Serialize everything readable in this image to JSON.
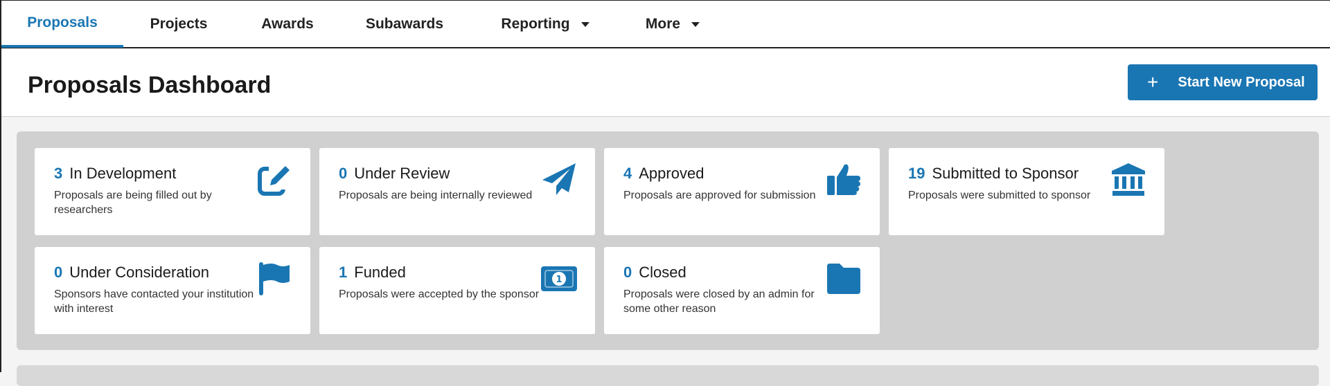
{
  "nav": {
    "tabs": [
      {
        "label": "Proposals"
      },
      {
        "label": "Projects"
      },
      {
        "label": "Awards"
      },
      {
        "label": "Subawards"
      },
      {
        "label": "Reporting"
      },
      {
        "label": "More"
      }
    ]
  },
  "header": {
    "title": "Proposals Dashboard",
    "new_button_label": "Start New Proposal"
  },
  "cards": [
    {
      "count": "3",
      "title": "In Development",
      "desc": "Proposals are being filled out by researchers",
      "icon": "edit-icon"
    },
    {
      "count": "0",
      "title": "Under Review",
      "desc": "Proposals are being internally reviewed",
      "icon": "paper-plane-icon"
    },
    {
      "count": "4",
      "title": "Approved",
      "desc": "Proposals are approved for submission",
      "icon": "thumbs-up-icon"
    },
    {
      "count": "19",
      "title": "Submitted to Sponsor",
      "desc": "Proposals were submitted to sponsor",
      "icon": "bank-icon"
    },
    {
      "count": "0",
      "title": "Under Consideration",
      "desc": "Sponsors have contacted your institution with interest",
      "icon": "flag-icon"
    },
    {
      "count": "1",
      "title": "Funded",
      "desc": "Proposals were accepted by the sponsor",
      "icon": "money-icon"
    },
    {
      "count": "0",
      "title": "Closed",
      "desc": "Proposals were closed by an admin for some other reason",
      "icon": "folder-icon"
    }
  ],
  "colors": {
    "accent": "#1a76b3"
  }
}
